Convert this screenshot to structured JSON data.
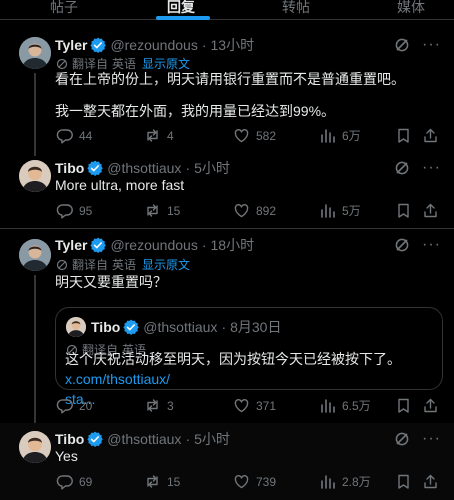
{
  "tabs": [
    "帖子",
    "回复",
    "转帖",
    "媒体"
  ],
  "colors": {
    "accent": "#1d9bf0",
    "muted": "#71767b",
    "text": "#e7e9ea",
    "border": "#2f3336"
  },
  "tweets": [
    {
      "name": "Tyler",
      "handle": "@rezoundous",
      "time": "13小时",
      "translate": {
        "prefix": "翻译自",
        "lang": "英语",
        "show": "显示原文"
      },
      "lines": [
        "看在上帝的份上，明天请用银行重置而不是普通重置吧。",
        "我一整天都在外面，我的用量已经达到99%。"
      ],
      "stats": {
        "replies": "44",
        "reposts": "4",
        "likes": "582",
        "views": "6万"
      }
    },
    {
      "name": "Tibo",
      "handle": "@thsottiaux",
      "time": "5小时",
      "lines": [
        "More ultra, more fast"
      ],
      "stats": {
        "replies": "95",
        "reposts": "15",
        "likes": "892",
        "views": "5万"
      }
    },
    {
      "name": "Tyler",
      "handle": "@rezoundous",
      "time": "18小时",
      "translate": {
        "prefix": "翻译自",
        "lang": "英语",
        "show": "显示原文"
      },
      "lines": [
        "明天又要重置吗？"
      ],
      "quote": {
        "name": "Tibo",
        "handle": "@thsottiaux",
        "time": "8月30日",
        "translate": {
          "prefix": "翻译自",
          "lang": "英语"
        },
        "text": "这个庆祝活动移至明天，因为按钮今天已经被按下了。",
        "link": "x.com/thsottiaux/",
        "text2": "sta..."
      },
      "stats": {
        "replies": "20",
        "reposts": "3",
        "likes": "371",
        "views": "6.5万"
      }
    },
    {
      "name": "Tibo",
      "handle": "@thsottiaux",
      "time": "5小时",
      "lines": [
        "Yes"
      ],
      "stats": {
        "replies": "69",
        "reposts": "15",
        "likes": "739",
        "views": "2.8万"
      }
    }
  ]
}
